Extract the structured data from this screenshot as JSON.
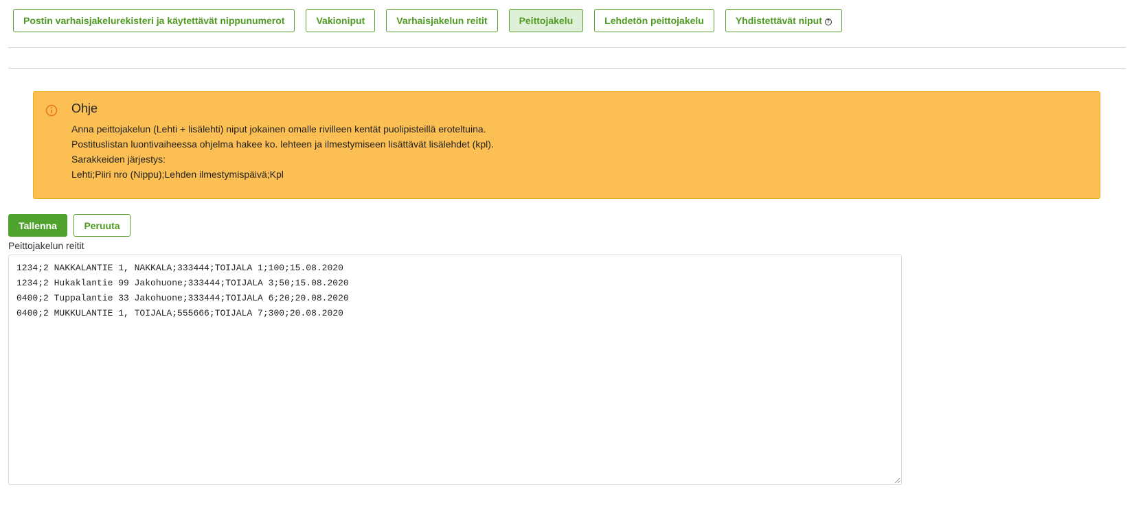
{
  "tabs": [
    {
      "label": "Postin varhaisjakelurekisteri ja käytettävät nippunumerot",
      "active": false
    },
    {
      "label": "Vakioniput",
      "active": false
    },
    {
      "label": "Varhaisjakelun reitit",
      "active": false
    },
    {
      "label": "Peittojakelu",
      "active": true
    },
    {
      "label": "Lehdetön peittojakelu",
      "active": false
    },
    {
      "label": "Yhdistettävät niput",
      "active": false
    }
  ],
  "help_icon_glyph": "?",
  "alert": {
    "icon": "info-icon",
    "title": "Ohje",
    "lines": [
      "Anna peittojakelun (Lehti + lisälehti) niput jokainen omalle rivilleen kentät puolipisteillä eroteltuina.",
      "Postituslistan luontivaiheessa ohjelma hakee ko. lehteen ja ilmestymiseen lisättävät lisälehdet (kpl).",
      "Sarakkeiden järjestys:",
      "Lehti;Piiri nro (Nippu);Lehden ilmestymispäivä;Kpl"
    ]
  },
  "buttons": {
    "save_label": "Tallenna",
    "cancel_label": "Peruuta"
  },
  "routes_field": {
    "label": "Peittojakelun reitit",
    "value": "1234;2 NAKKALANTIE 1, NAKKALA;333444;TOIJALA 1;100;15.08.2020\n1234;2 Hukaklantie 99 Jakohuone;333444;TOIJALA 3;50;15.08.2020\n0400;2 Tuppalantie 33 Jakohuone;333444;TOIJALA 6;20;20.08.2020\n0400;2 MUKKULANTIE 1, TOIJALA;555666;TOIJALA 7;300;20.08.2020"
  },
  "colors": {
    "accent_green": "#4fa22e",
    "alert_bg": "#fcbf53",
    "active_tab_bg": "#dff0d8"
  }
}
